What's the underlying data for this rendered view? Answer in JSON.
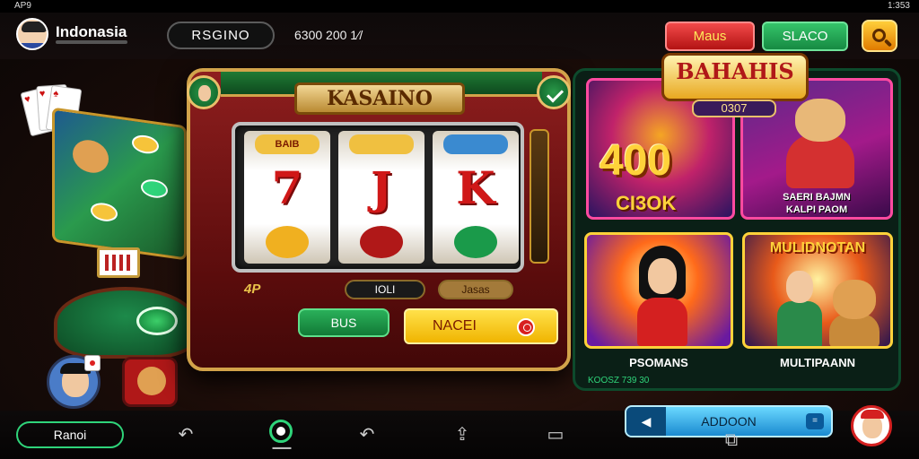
{
  "status_bar": {
    "left": "AP9",
    "right": "1:353"
  },
  "header": {
    "brand": "Indonasia",
    "tab_label": "RSGINO",
    "balance": "6300 200 1⁄/",
    "red_button": "Maus",
    "green_button": "SLACO",
    "search_icon": "search-icon"
  },
  "slot_machine": {
    "title": "KASAINO",
    "reel_labels": [
      "BAIB",
      "",
      ""
    ],
    "reel_symbols": [
      "7",
      "J",
      "K"
    ],
    "bet_display": "4P",
    "stat_a": "IOLI",
    "stat_b": "Jasas",
    "bus_button": "BUS",
    "place_button": "NACEI"
  },
  "promos": {
    "banner_title": "BAHAHIS",
    "banner_sub": "0307",
    "big_number": "400",
    "big_sub": "CI3OK",
    "tile2_caption_line1": "SAERI BAJMN",
    "tile2_caption_line2": "KALPI PAOM",
    "tile4_title": "MULIDNOTAN",
    "caption_a": "PSOMANS",
    "caption_b": "MULTIPAANN",
    "small_note": "KOOSZ 739 30"
  },
  "bottom_nav": {
    "left_pill": "Ranoi",
    "action_button": "ADDOON",
    "icons": [
      "back-icon",
      "home-icon",
      "back-icon",
      "upload-icon",
      "recents-icon",
      "screen-icon"
    ]
  },
  "colors": {
    "accent_green": "#2fd47a",
    "accent_gold": "#d2a34a",
    "accent_red": "#d42020"
  }
}
